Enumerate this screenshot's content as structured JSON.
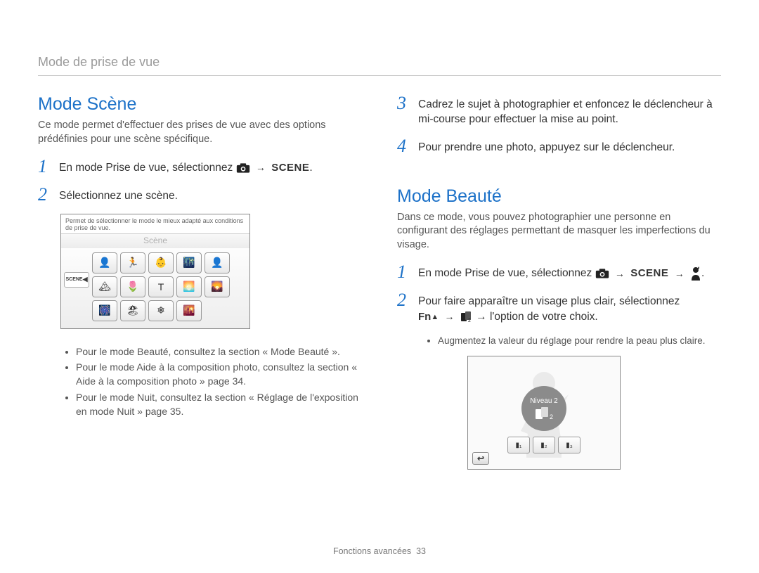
{
  "breadcrumb": "Mode de prise de vue",
  "left": {
    "title": "Mode Scène",
    "intro": "Ce mode permet d'effectuer des prises de vue avec des options prédéfinies pour une scène spécifique.",
    "steps": {
      "s1": "En mode Prise de vue, sélectionnez",
      "s1_after": ".",
      "s2": "Sélectionnez une scène."
    },
    "scene_shot": {
      "hint": "Permet de sélectionner le mode le mieux adapté aux conditions de prise de vue.",
      "label": "Scène",
      "left_btn": "SCENE",
      "icons": [
        "👤",
        "🏃",
        "👶",
        "🌃",
        "👤",
        "🏔",
        "🌷",
        "T",
        "🌅",
        "🌄",
        "🎆",
        "🏖",
        "❄",
        "🌇"
      ]
    },
    "bullets": [
      "Pour le mode Beauté, consultez la section « Mode Beauté ».",
      "Pour le mode Aide à la composition photo, consultez la section « Aide à la composition photo » page 34.",
      "Pour le mode Nuit, consultez la section « Réglage de l'exposition en mode Nuit » page 35."
    ]
  },
  "right": {
    "steps_top": {
      "s3": "Cadrez le sujet à photographier et enfoncez le déclencheur à mi-course pour effectuer la mise au point.",
      "s4": "Pour prendre une photo, appuyez sur le déclencheur."
    },
    "title": "Mode Beauté",
    "intro": "Dans ce mode, vous pouvez photographier une personne en configurant des réglages permettant de masquer les imperfections du visage.",
    "steps": {
      "s1": "En mode Prise de vue, sélectionnez",
      "s1_after": ".",
      "s2_a": "Pour faire apparaître un visage plus clair, sélectionnez",
      "s2_b": "→ l'option de votre choix."
    },
    "sub_bullets": [
      "Augmentez la valeur du réglage pour rendre la peau plus claire."
    ],
    "beauty_shot": {
      "level_label": "Niveau 2",
      "levels": [
        "▮₁",
        "▮₂",
        "▮₃"
      ],
      "back": "↩"
    }
  },
  "footer": {
    "section": "Fonctions avancées",
    "page": "33"
  },
  "icons": {
    "camera": "camera-icon",
    "scene": "SCENE",
    "fn": "Fn",
    "face_tool": "face-tool-icon",
    "person": "person-retouch-icon"
  }
}
